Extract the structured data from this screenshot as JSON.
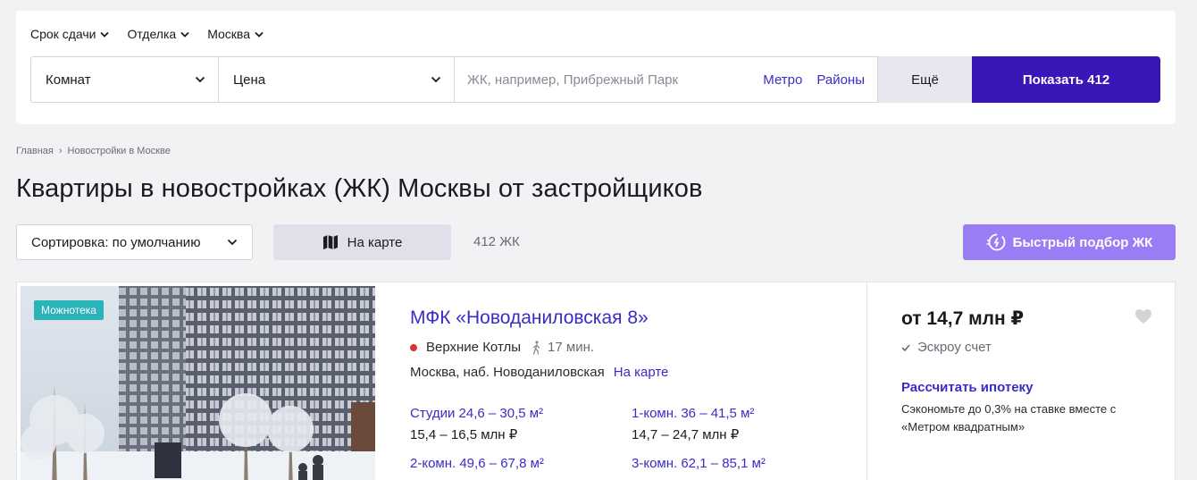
{
  "filters": {
    "quick": [
      {
        "label": "Срок сдачи"
      },
      {
        "label": "Отделка"
      },
      {
        "label": "Москва"
      }
    ],
    "rooms_label": "Комнат",
    "price_label": "Цена",
    "search_placeholder": "ЖК, например, Прибрежный Парк",
    "metro_link": "Метро",
    "districts_link": "Районы",
    "more_label": "Ещё",
    "show_label": "Показать 412"
  },
  "breadcrumb": {
    "home": "Главная",
    "separator": "›",
    "current": "Новостройки в Москве"
  },
  "page_title": "Квартиры в новостройках (ЖК) Москвы от застройщиков",
  "toolbar": {
    "sort_label": "Сортировка: по умолчанию",
    "map_label": "На карте",
    "count": "412 ЖК",
    "quick_pick_label": "Быстрый подбор ЖК"
  },
  "listing": {
    "badge": "Можнотека",
    "title": "МФК «Новоданиловская 8»",
    "metro_station": "Верхние Котлы",
    "metro_color": "#dd3333",
    "walk_time": "17 мин.",
    "address": "Москва, наб. Новоданиловская",
    "on_map": "На карте",
    "apartments": [
      {
        "type": "Студии 24,6 – 30,5 м²",
        "price": "15,4 – 16,5 млн ₽"
      },
      {
        "type": "1-комн. 36 – 41,5 м²",
        "price": "14,7 – 24,7 млн ₽"
      },
      {
        "type": "2-комн. 49,6 – 67,8 м²",
        "price": ""
      },
      {
        "type": "3-комн. 62,1 – 85,1 м²",
        "price": ""
      }
    ],
    "price_from": "от 14,7 млн ₽",
    "escrow": "Эскроу счет",
    "mortgage_link": "Рассчитать ипотеку",
    "mortgage_desc": "Сэкономьте до 0,3% на ставке вместе с «Метром квадратным»"
  },
  "colors": {
    "accent": "#3a2cc7",
    "primary_button": "#3a16b8",
    "quick_pick_button": "#9a7cf5",
    "badge": "#2ab3b8"
  }
}
